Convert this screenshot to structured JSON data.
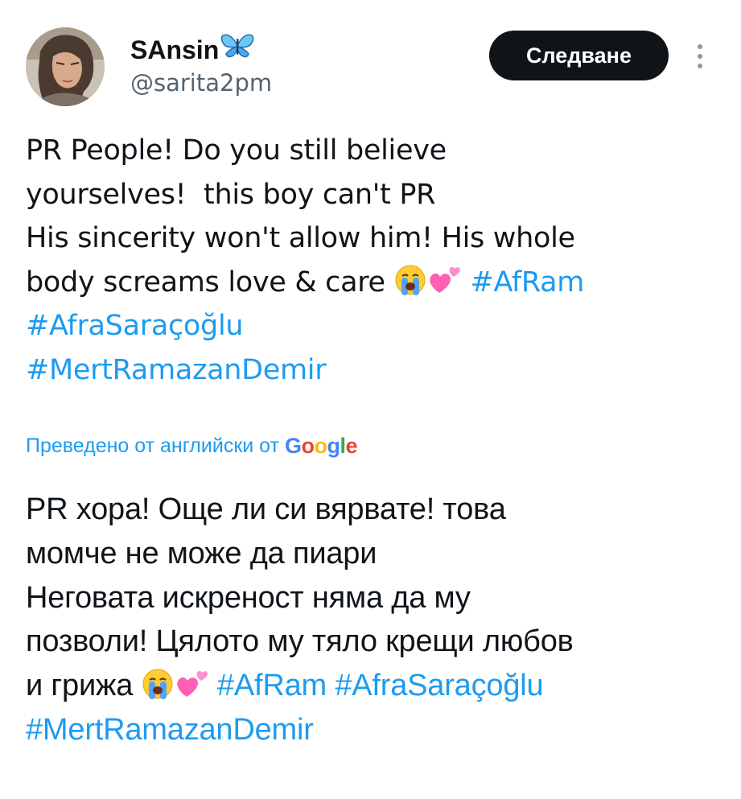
{
  "user": {
    "display_name": "SAnsin",
    "name_emoji": "butterfly-icon",
    "handle": "@sarita2pm",
    "avatar": "avatar"
  },
  "follow_button": {
    "label": "Следване"
  },
  "more_menu": {
    "icon": "more-vertical-icon"
  },
  "tweet": {
    "line1": "PR People! Do you still believe",
    "line2": "yourselves!  this boy can't PR",
    "line3": "His sincerity won't allow him! His whole",
    "line4": "body screams love & care ",
    "emoji1": "loudly-crying-face-icon",
    "emoji2": "two-hearts-icon",
    "hashtag_afram": "#AfRam",
    "hashtag_afra": "#AfraSaraçoğlu",
    "hashtag_mert": "#MertRamazanDemir"
  },
  "translation": {
    "label": "Преведено от английски от",
    "google_logo": "Google",
    "line1": "PR хора! Още ли си вярвате! това",
    "line2": "момче не може да пиари",
    "line3": "Неговата искреност няма да му",
    "line4": "позволи! Цялото му тяло крещи любов",
    "line5": "и грижа ",
    "hashtag_afram": "#AfRam",
    "hashtag_afra": "#AfraSaraçoğlu",
    "hashtag_mert": "#MertRamazanDemir"
  },
  "colors": {
    "text": "#0f1419",
    "secondary": "#536471",
    "link": "#1d9bf0",
    "button_bg": "#0f1419"
  }
}
